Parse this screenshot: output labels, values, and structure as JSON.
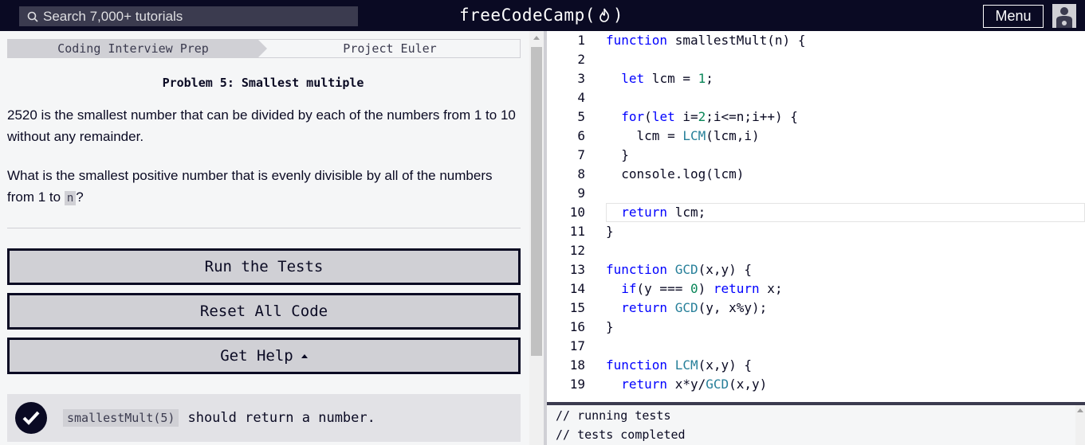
{
  "nav": {
    "search_placeholder": "Search 7,000+ tutorials",
    "logo_text": "freeCodeCamp",
    "logo_paren_open": "(",
    "logo_paren_close": ")",
    "menu_label": "Menu"
  },
  "breadcrumb": {
    "items": [
      "Coding Interview Prep",
      "Project Euler"
    ]
  },
  "challenge": {
    "title": "Problem 5: Smallest multiple",
    "paragraph1": "2520 is the smallest number that can be divided by each of the numbers from 1 to 10 without any remainder.",
    "paragraph2_before": "What is the smallest positive number that is evenly divisible by all of the numbers from 1 to ",
    "paragraph2_code": "n",
    "paragraph2_after": "?"
  },
  "buttons": {
    "run": "Run the Tests",
    "reset": "Reset All Code",
    "help": "Get Help"
  },
  "tests": [
    {
      "code": "smallestMult(5)",
      "text": "should return a number.",
      "passed": true
    }
  ],
  "editor": {
    "current_line": 10,
    "lines": [
      {
        "n": "1",
        "code": "function smallestMult(n) {"
      },
      {
        "n": "2",
        "code": ""
      },
      {
        "n": "3",
        "code": "  let lcm = 1;"
      },
      {
        "n": "4",
        "code": ""
      },
      {
        "n": "5",
        "code": "  for(let i=2;i<=n;i++) {"
      },
      {
        "n": "6",
        "code": "    lcm = LCM(lcm,i)"
      },
      {
        "n": "7",
        "code": "  }"
      },
      {
        "n": "8",
        "code": "  console.log(lcm)"
      },
      {
        "n": "9",
        "code": ""
      },
      {
        "n": "10",
        "code": "  return lcm;"
      },
      {
        "n": "11",
        "code": "}"
      },
      {
        "n": "12",
        "code": ""
      },
      {
        "n": "13",
        "code": "function GCD(x,y) {"
      },
      {
        "n": "14",
        "code": "  if(y === 0) return x;"
      },
      {
        "n": "15",
        "code": "  return GCD(y, x%y);"
      },
      {
        "n": "16",
        "code": "}"
      },
      {
        "n": "17",
        "code": ""
      },
      {
        "n": "18",
        "code": "function LCM(x,y) {"
      },
      {
        "n": "19",
        "code": "  return x*y/GCD(x,y)"
      }
    ]
  },
  "console": {
    "lines": [
      "// running tests",
      "// tests completed"
    ]
  },
  "colors": {
    "nav_bg": "#0a0a23",
    "button_bg": "#d0d0d5",
    "keyword": "#0000ff",
    "function": "#267f99",
    "number": "#098658"
  }
}
